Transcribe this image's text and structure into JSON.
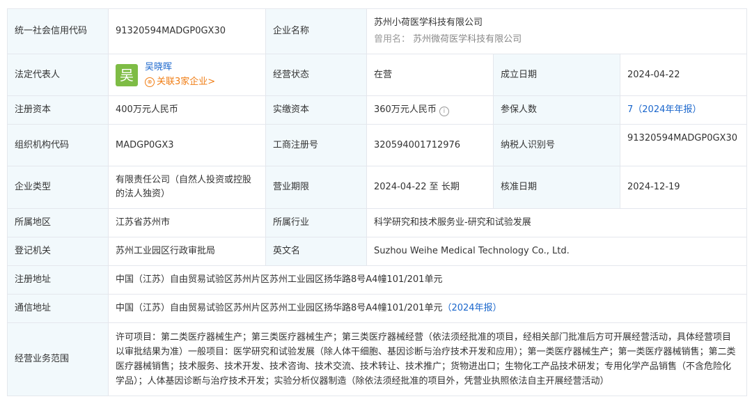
{
  "rows": {
    "credit_code": {
      "label": "统一社会信用代码",
      "value": "91320594MADGP0GX30"
    },
    "company_name": {
      "label": "企业名称",
      "value": "苏州小荷医学科技有限公司",
      "former_label": "曾用名：",
      "former_value": "苏州微荷医学科技有限公司"
    },
    "legal_rep": {
      "label": "法定代表人",
      "avatar_char": "吴",
      "name": "吴晓晖",
      "related": "关联3家企业>"
    },
    "status": {
      "label": "经营状态",
      "value": "在营"
    },
    "founded": {
      "label": "成立日期",
      "value": "2024-04-22"
    },
    "reg_capital": {
      "label": "注册资本",
      "value": "400万元人民币"
    },
    "paid_capital": {
      "label": "实缴资本",
      "value": "360万元人民币"
    },
    "insured": {
      "label": "参保人数",
      "value": "7",
      "report": "（2024年年报）"
    },
    "org_code": {
      "label": "组织机构代码",
      "value": "MADGP0GX3"
    },
    "biz_reg_no": {
      "label": "工商注册号",
      "value": "320594001712976"
    },
    "taxpayer_id": {
      "label": "纳税人识别号",
      "value": "91320594MADGP0GX30"
    },
    "company_type": {
      "label": "企业类型",
      "value": "有限责任公司（自然人投资或控股的法人独资）"
    },
    "biz_term": {
      "label": "营业期限",
      "value": "2024-04-22 至 长期"
    },
    "approval_date": {
      "label": "核准日期",
      "value": "2024-12-19"
    },
    "region": {
      "label": "所属地区",
      "value": "江苏省苏州市"
    },
    "industry": {
      "label": "所属行业",
      "value": "科学研究和技术服务业-研究和试验发展"
    },
    "authority": {
      "label": "登记机关",
      "value": "苏州工业园区行政审批局"
    },
    "english_name": {
      "label": "英文名",
      "value": "Suzhou Weihe Medical Technology Co., Ltd."
    },
    "reg_address": {
      "label": "注册地址",
      "value": "中国（江苏）自由贸易试验区苏州片区苏州工业园区扬华路8号A4幢101/201单元"
    },
    "mail_address": {
      "label": "通信地址",
      "value": "中国（江苏）自由贸易试验区苏州片区苏州工业园区扬华路8号A4幢101/201单元",
      "report": "（2024年报）"
    },
    "scope": {
      "label": "经营业务范围",
      "value": "许可项目：第二类医疗器械生产；第三类医疗器械生产；第三类医疗器械经营（依法须经批准的项目，经相关部门批准后方可开展经营活动，具体经营项目以审批结果为准）一般项目：医学研究和试验发展（除人体干细胞、基因诊断与治疗技术开发和应用）；第一类医疗器械生产；第一类医疗器械销售；第二类医疗器械销售；技术服务、技术开发、技术咨询、技术交流、技术转让、技术推广；货物进出口；生物化工产品技术研发；专用化学产品销售（不含危险化学品）；人体基因诊断与治疗技术开发；实验分析仪器制造（除依法须经批准的项目外，凭营业执照依法自主开展经营活动）"
    }
  }
}
